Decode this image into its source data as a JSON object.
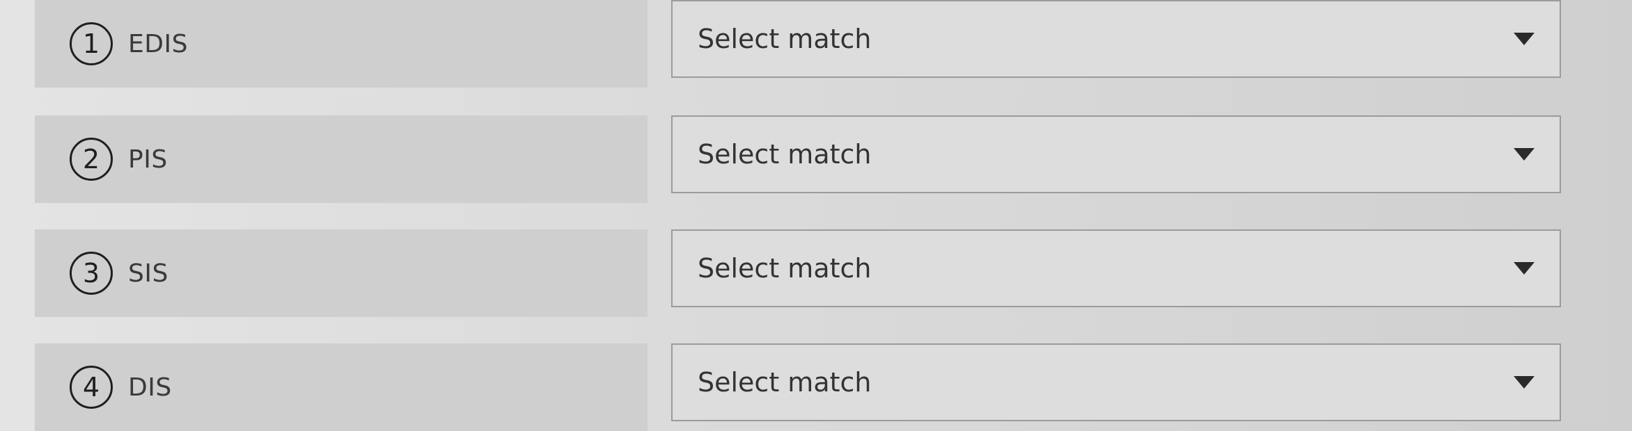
{
  "matching": {
    "items": [
      {
        "number": "1",
        "label": "EDIS",
        "select_value": "Select match"
      },
      {
        "number": "2",
        "label": "PIS",
        "select_value": "Select match"
      },
      {
        "number": "3",
        "label": "SIS",
        "select_value": "Select match"
      },
      {
        "number": "4",
        "label": "DIS",
        "select_value": "Select match"
      }
    ]
  },
  "icons": {
    "dropdown": "chevron-down-icon"
  }
}
